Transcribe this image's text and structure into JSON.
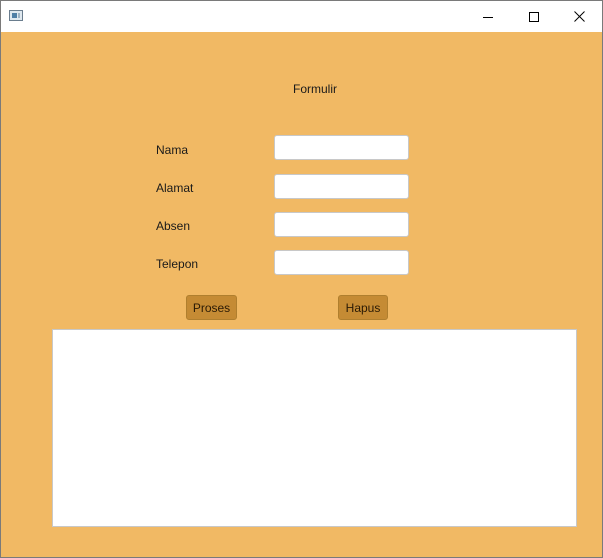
{
  "window": {
    "title": "",
    "icons": {
      "app": "app-window-icon",
      "minimize": "minimize-icon",
      "maximize": "maximize-icon",
      "close": "close-icon"
    }
  },
  "form": {
    "title": "Formulir",
    "fields": [
      {
        "label": "Nama",
        "value": "",
        "placeholder": ""
      },
      {
        "label": "Alamat",
        "value": "",
        "placeholder": ""
      },
      {
        "label": "Absen",
        "value": "",
        "placeholder": ""
      },
      {
        "label": "Telepon",
        "value": "",
        "placeholder": ""
      }
    ],
    "buttons": {
      "proses": "Proses",
      "hapus": "Hapus"
    },
    "output_text": ""
  },
  "colors": {
    "background": "#f1b964",
    "button": "#c58b34",
    "titlebar": "#ffffff"
  }
}
